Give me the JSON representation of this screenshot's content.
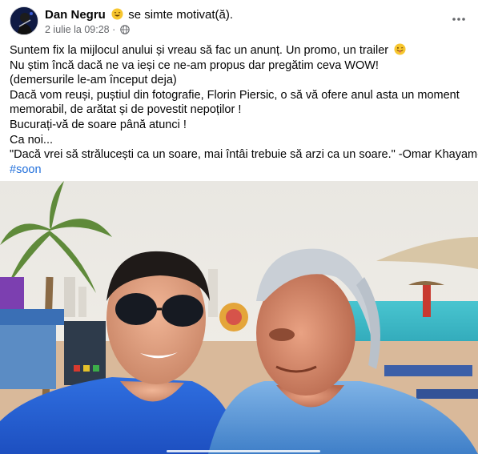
{
  "post": {
    "author": "Dan Negru",
    "feeling": "se simte motivat(ă).",
    "timestamp": "2 iulie la 09:28",
    "separator": "·",
    "more_icon": "more-horizontal-icon",
    "privacy_icon": "globe-icon",
    "feeling_icon": "smiling-face-emoji-icon",
    "lines": [
      "Suntem fix la mijlocul anului și vreau să fac un anunț. Un promo, un trailer",
      "Nu știm încă dacă ne va ieși ce ne-am propus dar pregătim ceva WOW!",
      "(demersurile le-am început deja)",
      "Dacă vom reuși, puștiul din fotografie, Florin Piersic, o să vă ofere anul asta un moment",
      "memorabil, de arătat și de povestit nepoților !",
      "Bucurați-vă de soare până atunci !",
      "Ca noi...",
      "\"Dacă vrei să strălucești ca un soare, mai întâi trebuie să arzi ca un soare.\" -Omar Khayam-"
    ],
    "trailer_emoji_icon": "tongue-out-emoji-icon",
    "hashtag": "#soon"
  },
  "colors": {
    "link": "#216fdb",
    "secondary_text": "#65676b",
    "primary_text": "#050505"
  }
}
